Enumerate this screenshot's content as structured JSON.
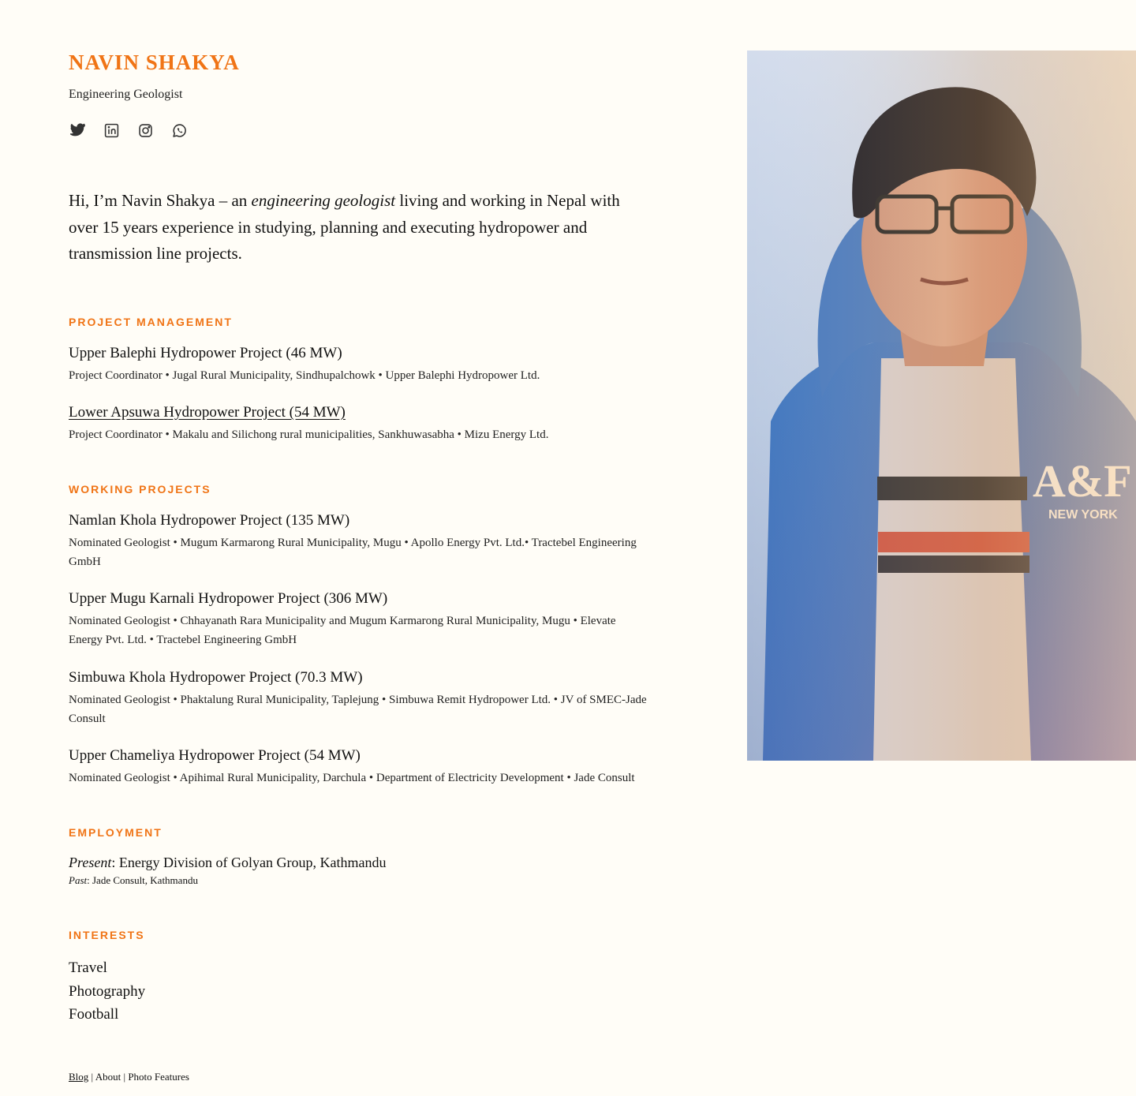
{
  "profile": {
    "name": "NAVIN SHAKYA",
    "subtitle": "Engineering Geologist",
    "social_icons": [
      "twitter-icon",
      "linkedin-icon",
      "instagram-icon",
      "whatsapp-icon"
    ]
  },
  "intro": {
    "before": "Hi, I’m Navin Shakya – an ",
    "emphasis": "engineering geologist",
    "after": " living and working in Nepal with over 15 years experience in studying, planning and executing hydropower and transmission line projects."
  },
  "project_management": {
    "title": "PROJECT MANAGEMENT",
    "items": [
      {
        "name": "Upper Balephi Hydropower Project (46 MW)",
        "desc": "Project Coordinator • Jugal Rural Municipality, Sindhupalchowk • Upper Balephi Hydropower Ltd."
      },
      {
        "name": "Lower Apsuwa Hydropower Project (54 MW)",
        "desc": "Project Coordinator • Makalu and Silichong rural municipalities, Sankhuwasabha • Mizu Energy Ltd."
      }
    ]
  },
  "working_projects": {
    "title": "WORKING PROJECTS",
    "items": [
      {
        "name": "Namlan Khola Hydropower Project (135 MW)",
        "desc": "Nominated Geologist • Mugum Karmarong Rural Municipality, Mugu • Apollo Energy Pvt. Ltd.• Tractebel Engineering GmbH"
      },
      {
        "name": "Upper Mugu Karnali Hydropower Project (306 MW)",
        "desc": "Nominated Geologist • Chhayanath Rara Municipality and Mugum Karmarong Rural Municipality, Mugu • Elevate Energy Pvt. Ltd. • Tractebel Engineering GmbH"
      },
      {
        "name": "Simbuwa Khola Hydropower Project (70.3 MW)",
        "desc": "Nominated Geologist • Phaktalung Rural Municipality, Taplejung • Simbuwa Remit Hydropower Ltd. • JV of SMEC-Jade Consult"
      },
      {
        "name": "Upper Chameliya Hydropower Project (54 MW)",
        "desc": "Nominated Geologist • Apihimal Rural Municipality, Darchula • Department of Electricity Development • Jade Consult"
      }
    ]
  },
  "employment": {
    "title": "EMPLOYMENT",
    "present_label": "Present",
    "present_value": ": Energy Division of Golyan Group, Kathmandu",
    "past_label": "Past",
    "past_value": ": Jade Consult, Kathmandu"
  },
  "interests": {
    "title": "INTERESTS",
    "items": [
      "Travel",
      "Photography",
      "Football"
    ]
  },
  "footer": {
    "links": [
      "Blog",
      "About",
      "Photo Features"
    ],
    "separator": "|"
  },
  "colors": {
    "accent": "#f07416",
    "background": "#fffdf7",
    "text": "#111111"
  }
}
